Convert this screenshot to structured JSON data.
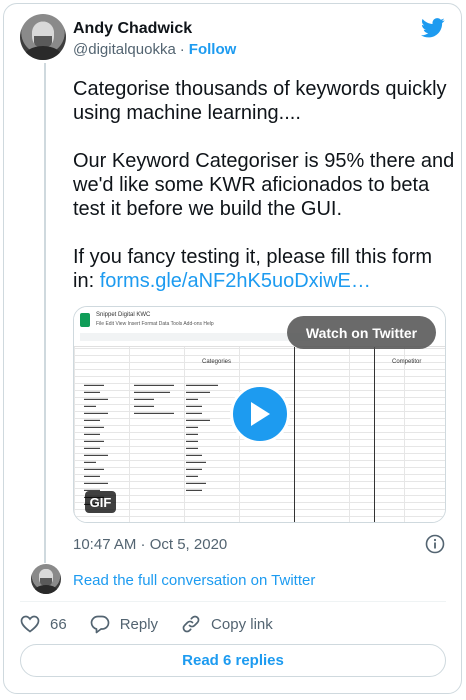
{
  "author": {
    "name": "Andy Chadwick",
    "handle": "@digitalquokka",
    "follow_label": "Follow"
  },
  "tweet": {
    "paragraphs": [
      "Categorise thousands of keywords quickly using machine learning....",
      "Our Keyword Categoriser is 95% there and we'd like some KWR aficionados to beta test it before we build the GUI.",
      "If you fancy testing it, please fill this form in:"
    ],
    "link_text": "forms.gle/aNF2hK5uoDxiwE…"
  },
  "media": {
    "watch_label": "Watch on Twitter",
    "gif_badge": "GIF",
    "sheet_title": "Snippet Digital KWC",
    "sheet_menu": "File  Edit  View  Insert  Format  Data  Tools  Add-ons  Help",
    "categories_label": "Categories",
    "competitor_label": "Competitor"
  },
  "timestamp": "10:47 AM · Oct 5, 2020",
  "read_conversation": "Read the full conversation on Twitter",
  "actions": {
    "like_count": "66",
    "reply_label": "Reply",
    "copy_link_label": "Copy link"
  },
  "read_replies": "Read 6 replies",
  "colors": {
    "accent": "#1d9bf0",
    "text": "#0f1419",
    "muted": "#536471",
    "border": "#cfd9de"
  }
}
